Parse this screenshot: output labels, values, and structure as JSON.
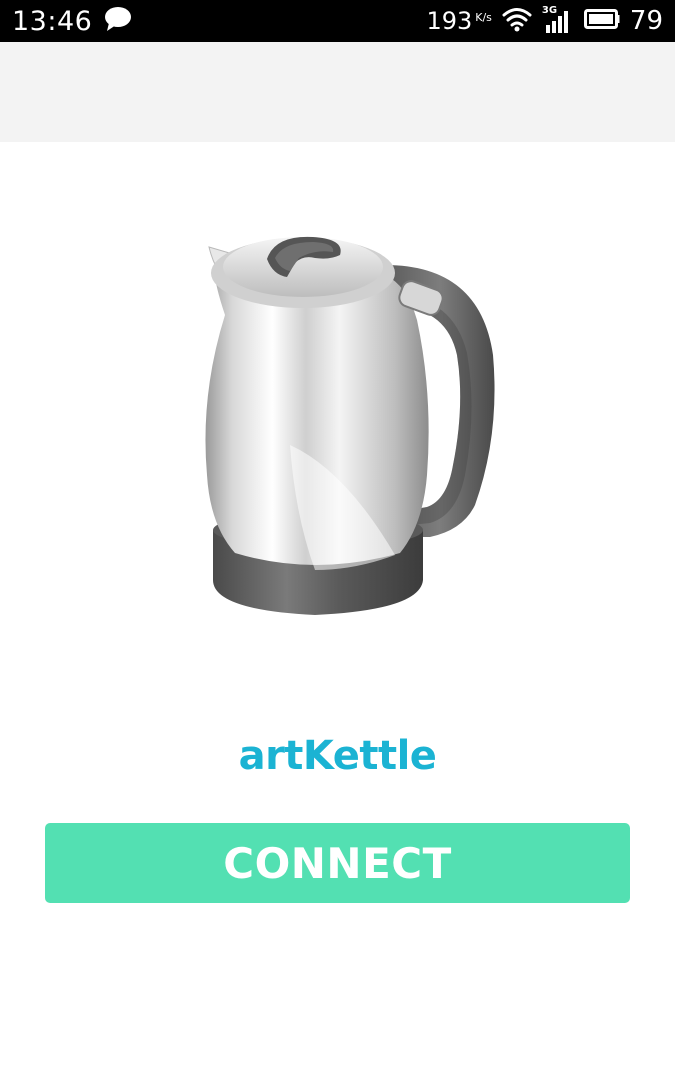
{
  "status_bar": {
    "time": "13:46",
    "message_icon": "chat-bubble-icon",
    "net_speed": "193",
    "net_speed_unit": "K/s",
    "wifi_icon": "wifi-icon",
    "network_type": "3G",
    "signal_icon": "signal-icon",
    "battery_icon": "battery-icon",
    "battery_level": "79"
  },
  "device": {
    "image_icon": "electric-kettle-icon",
    "name": "artKettle",
    "name_color": "#1BB3D3"
  },
  "actions": {
    "connect_label": "CONNECT",
    "connect_color": "#53E0B2"
  }
}
